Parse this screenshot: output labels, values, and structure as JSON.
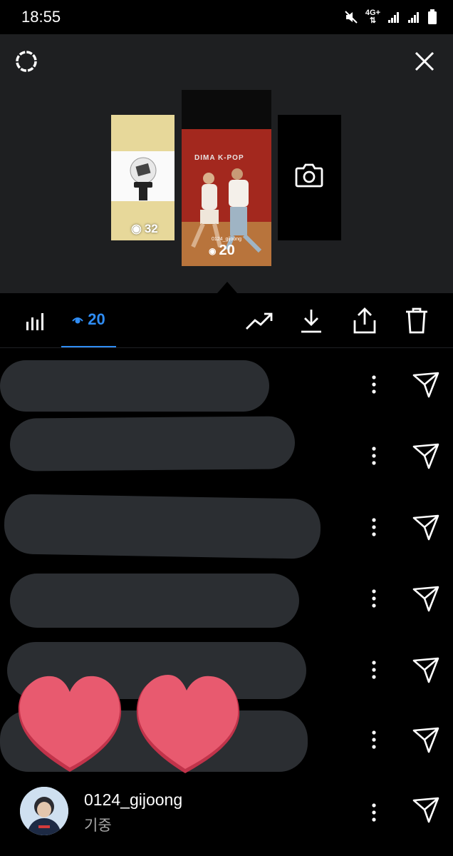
{
  "status_bar": {
    "time": "18:55",
    "network": "4G+",
    "icons": [
      "mute-icon",
      "network-icon",
      "signal-icon",
      "signal-icon",
      "battery-icon"
    ]
  },
  "top_panel": {
    "settings_icon": "gear-icon",
    "close_icon": "close-icon",
    "stories": [
      {
        "type": "image",
        "view_count": "32"
      },
      {
        "type": "video",
        "wall_text": "DIMA K-POP",
        "caption": "0124_gijoong",
        "view_count": "20"
      },
      {
        "type": "camera",
        "icon": "camera-icon"
      }
    ]
  },
  "toolbar": {
    "views_count": "20",
    "icons": [
      "bar-chart-icon",
      "eye-icon",
      "trending-icon",
      "download-icon",
      "share-icon",
      "trash-icon"
    ],
    "accent_color": "#2f8df5"
  },
  "viewers": {
    "redacted_rows": 6,
    "last_viewer": {
      "username": "0124_gijoong",
      "display_name": "기중"
    }
  }
}
